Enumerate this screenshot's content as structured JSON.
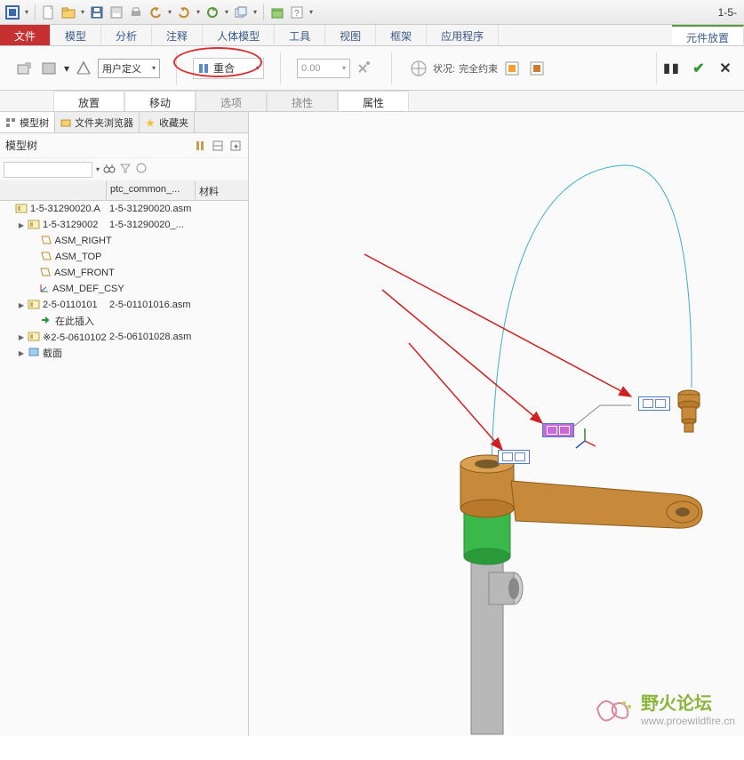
{
  "title_right": "1-5-",
  "menu": {
    "file": "文件",
    "model": "模型",
    "analysis": "分析",
    "annotate": "注释",
    "manikin": "人体模型",
    "tools": "工具",
    "view": "视图",
    "frame": "框架",
    "apps": "应用程序",
    "placement": "元件放置"
  },
  "ribbon": {
    "user_defined": "用户定义",
    "coincident": "重合",
    "offset_value": "0.00",
    "status_label": "状况:",
    "status_value": "完全约束"
  },
  "subtabs": {
    "placement": "放置",
    "move": "移动",
    "options": "选项",
    "flex": "挠性",
    "props": "属性"
  },
  "panel": {
    "tab_tree": "模型树",
    "tab_folder": "文件夹浏览器",
    "tab_fav": "收藏夹",
    "header": "模型树",
    "col2": "ptc_common_...",
    "col3": "材料"
  },
  "tree": [
    {
      "depth": 1,
      "tw": "",
      "icon": "asm",
      "label": "1-5-31290020.A",
      "col2": "1-5-31290020.asm"
    },
    {
      "depth": 2,
      "tw": "▶",
      "icon": "asm",
      "label": "1-5-3129002",
      "col2": "1-5-31290020_..."
    },
    {
      "depth": 3,
      "tw": "",
      "icon": "datum",
      "label": "ASM_RIGHT",
      "col2": ""
    },
    {
      "depth": 3,
      "tw": "",
      "icon": "datum",
      "label": "ASM_TOP",
      "col2": ""
    },
    {
      "depth": 3,
      "tw": "",
      "icon": "datum",
      "label": "ASM_FRONT",
      "col2": ""
    },
    {
      "depth": 3,
      "tw": "",
      "icon": "csys",
      "label": "ASM_DEF_CSY",
      "col2": ""
    },
    {
      "depth": 2,
      "tw": "▶",
      "icon": "asm",
      "label": "2-5-0110101",
      "col2": "2-5-01101016.asm"
    },
    {
      "depth": 3,
      "tw": "",
      "icon": "ins",
      "label": "在此插入",
      "col2": ""
    },
    {
      "depth": 2,
      "tw": "▶",
      "icon": "asm-cur",
      "label": "※2-5-0610102",
      "col2": "2-5-06101028.asm"
    },
    {
      "depth": 2,
      "tw": "▶",
      "icon": "sec",
      "label": "截面",
      "col2": ""
    }
  ],
  "watermark": {
    "line1": "野火论坛",
    "line2": "www.proewildfire.cn"
  }
}
